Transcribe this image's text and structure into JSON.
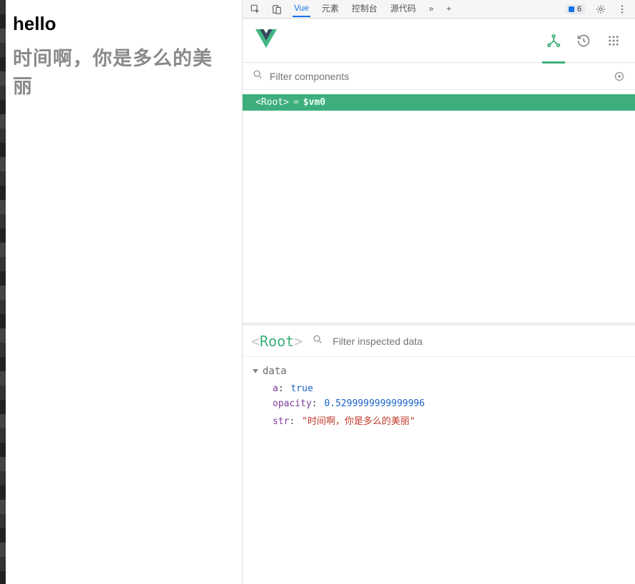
{
  "page": {
    "heading": "hello",
    "subtitle": "时间啊，你是多么的美丽"
  },
  "devtools": {
    "tabs": [
      "Vue",
      "元素",
      "控制台",
      "源代码"
    ],
    "more": "»",
    "add": "+",
    "badge": "6",
    "active_tab": "Vue"
  },
  "vue": {
    "filter_placeholder": "Filter components",
    "selected_node": "<Root>",
    "selected_eq": " = ",
    "selected_var": "$vm0"
  },
  "inspector": {
    "root_label": "Root",
    "filter_placeholder": "Filter inspected data",
    "section": "data",
    "props": {
      "a_key": "a",
      "a_val": "true",
      "opacity_key": "opacity",
      "opacity_val": "0.5299999999999996",
      "str_key": "str",
      "str_val": "\"时间啊，你是多么的美丽\""
    }
  }
}
